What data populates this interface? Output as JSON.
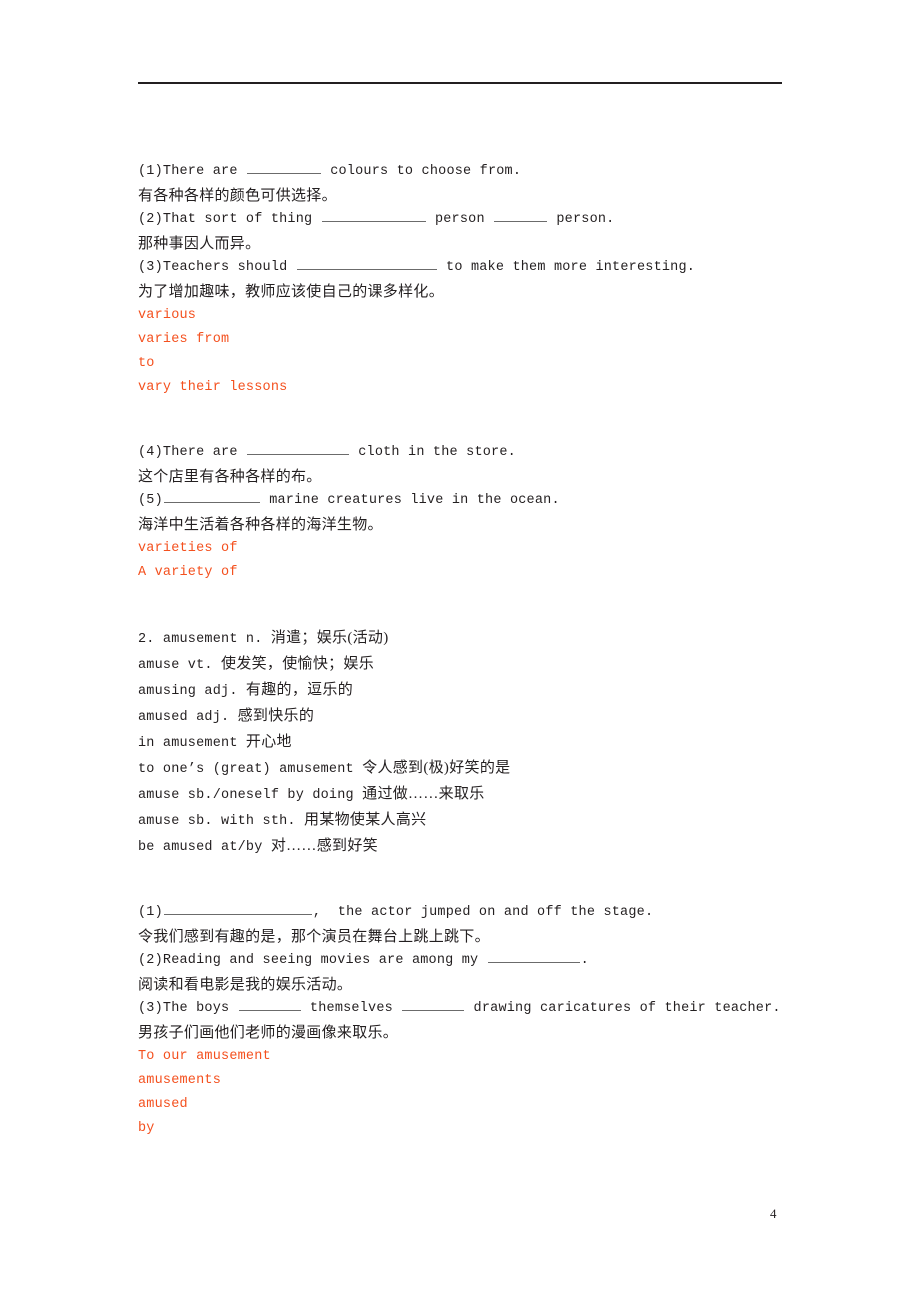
{
  "page": {
    "number": "4",
    "has_header_rule": true,
    "text_color": "#231f20",
    "answer_color": "#f4501e",
    "background": "#ffffff"
  },
  "blocks": [
    {
      "id": "vary-exercises-1",
      "lines": [
        {
          "kind": "exercise",
          "pre": "(1)There are ",
          "blank": "w1",
          "post": " colours to choose from."
        },
        {
          "kind": "chinese",
          "text": "有各种各样的颜色可供选择。"
        },
        {
          "kind": "exercise",
          "pre": "(2)That sort of thing ",
          "blank": "w2",
          "mid": " person ",
          "blank2": "w3",
          "post": " person."
        },
        {
          "kind": "chinese",
          "text": "那种事因人而异。"
        },
        {
          "kind": "exercise",
          "pre": "(3)Teachers should ",
          "blank": "w4",
          "post": " to make them more interesting."
        },
        {
          "kind": "chinese",
          "text": "为了增加趣味，教师应该使自己的课多样化。"
        },
        {
          "kind": "answer",
          "text": "various"
        },
        {
          "kind": "answer",
          "text": "varies from"
        },
        {
          "kind": "answer",
          "text": "to"
        },
        {
          "kind": "answer",
          "text": "vary their lessons"
        }
      ]
    },
    {
      "id": "vary-exercises-2",
      "lines": [
        {
          "kind": "exercise",
          "pre": "(4)There are ",
          "blank": "w5",
          "post": " cloth in the store."
        },
        {
          "kind": "chinese",
          "text": "这个店里有各种各样的布。"
        },
        {
          "kind": "exercise",
          "pre": "(5)",
          "blank": "w6",
          "post": " marine creatures live in the ocean."
        },
        {
          "kind": "chinese",
          "text": "海洋中生活着各种各样的海洋生物。"
        },
        {
          "kind": "answer",
          "text": "varieties of"
        },
        {
          "kind": "answer",
          "text": "A variety of"
        }
      ]
    },
    {
      "id": "amusement-entry",
      "lines": [
        {
          "kind": "mixed",
          "en": "2. amusement n. ",
          "cn": "消遣；娱乐(活动)"
        },
        {
          "kind": "mixed",
          "en": "amuse vt. ",
          "cn": "使发笑，使愉快；娱乐"
        },
        {
          "kind": "mixed",
          "en": "amusing adj. ",
          "cn": "有趣的，逗乐的"
        },
        {
          "kind": "mixed",
          "en": "amused adj. ",
          "cn": "感到快乐的"
        },
        {
          "kind": "mixed",
          "en": "in amusement ",
          "cn": "开心地"
        },
        {
          "kind": "mixed",
          "en": "to one’s (great) amusement ",
          "cn": "令人感到(极)好笑的是"
        },
        {
          "kind": "mixed",
          "en": "amuse sb./oneself by doing ",
          "cn": "通过做……来取乐"
        },
        {
          "kind": "mixed",
          "en": "amuse sb. with sth. ",
          "cn": "用某物使某人高兴"
        },
        {
          "kind": "mixed",
          "en": "be amused at/by ",
          "cn": "对……感到好笑"
        }
      ]
    },
    {
      "id": "amusement-exercises",
      "lines": [
        {
          "kind": "exercise",
          "pre": "(1)",
          "blank": "w7",
          "post": ",  the actor jumped on and off the stage."
        },
        {
          "kind": "chinese",
          "text": "令我们感到有趣的是，那个演员在舞台上跳上跳下。"
        },
        {
          "kind": "exercise",
          "pre": "(2)Reading and seeing movies are among my ",
          "blank": "w8",
          "post": "."
        },
        {
          "kind": "chinese",
          "text": "阅读和看电影是我的娱乐活动。"
        },
        {
          "kind": "exercise",
          "pre": "(3)The boys ",
          "blank": "w9",
          "mid": " themselves ",
          "blank2": "w9",
          "post": " drawing caricatures of their teacher."
        },
        {
          "kind": "chinese",
          "text": "男孩子们画他们老师的漫画像来取乐。"
        },
        {
          "kind": "answer",
          "text": "To our amusement"
        },
        {
          "kind": "answer",
          "text": "amusements"
        },
        {
          "kind": "answer",
          "text": "amused"
        },
        {
          "kind": "answer",
          "text": "by"
        }
      ]
    }
  ]
}
